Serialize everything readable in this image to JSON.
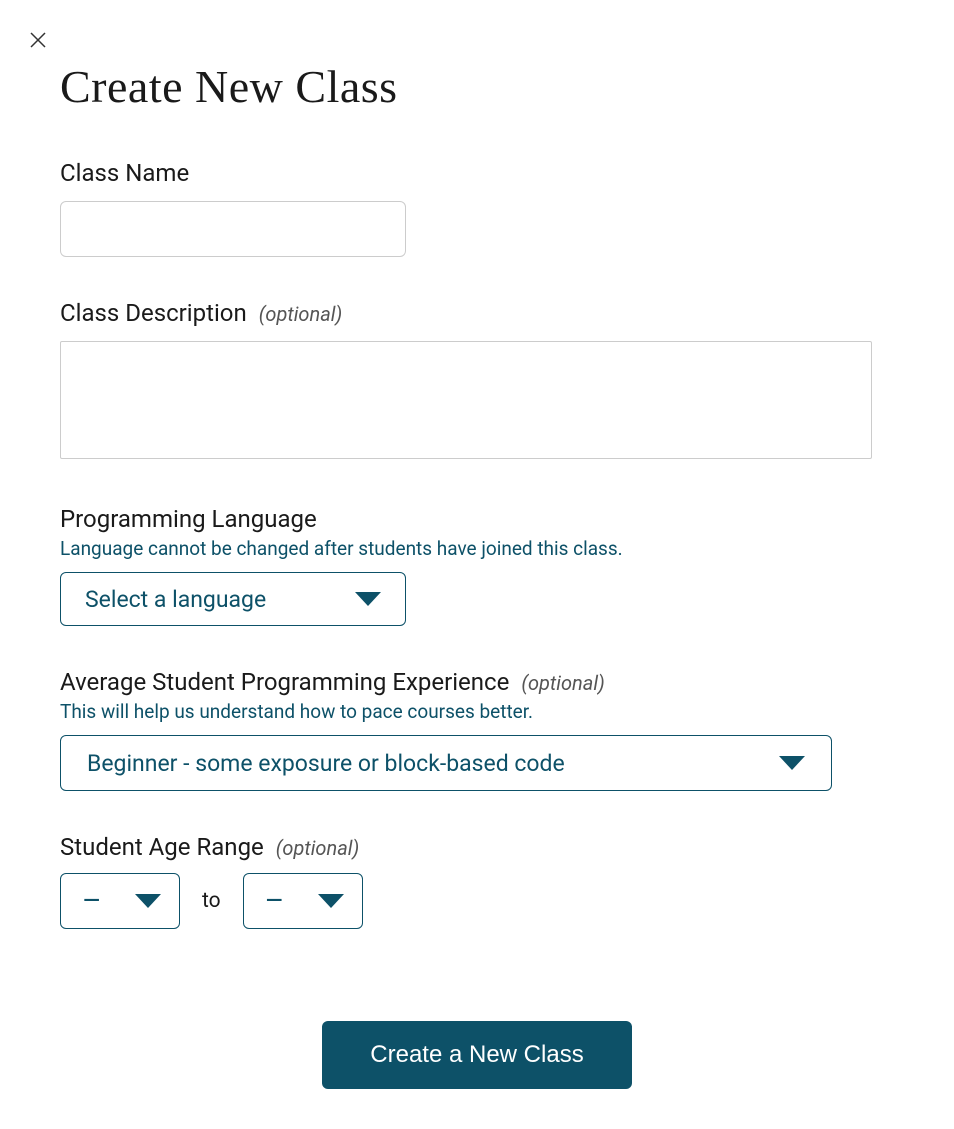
{
  "title": "Create New Class",
  "fields": {
    "className": {
      "label": "Class Name",
      "value": ""
    },
    "classDescription": {
      "label": "Class Description",
      "optional": "(optional)",
      "value": ""
    },
    "programmingLanguage": {
      "label": "Programming Language",
      "hint": "Language cannot be changed after students have joined this class.",
      "selected": "Select a language"
    },
    "experience": {
      "label": "Average Student Programming Experience",
      "optional": "(optional)",
      "hint": "This will help us understand how to pace courses better.",
      "selected": "Beginner - some exposure or block-based code"
    },
    "ageRange": {
      "label": "Student Age Range",
      "optional": "(optional)",
      "from": "—",
      "to": "—",
      "separator": "to"
    }
  },
  "submitLabel": "Create a New Class"
}
